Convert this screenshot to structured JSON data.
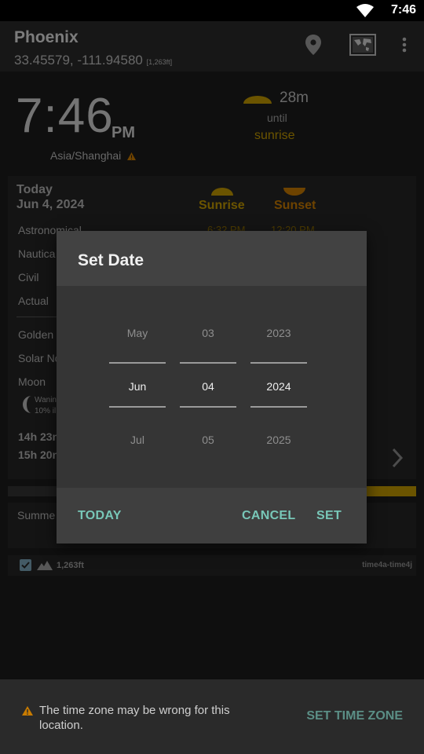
{
  "status_bar": {
    "time": "7:46"
  },
  "app_bar": {
    "title": "Phoenix",
    "coords": "33.45579, -111.94580",
    "elevation": "[1,263ft]"
  },
  "clock": {
    "time": "7:46",
    "ampm": "PM",
    "timezone": "Asia/Shanghai"
  },
  "countdown": {
    "value": "28m",
    "until": "until",
    "event": "sunrise"
  },
  "today_card": {
    "label": "Today",
    "date": "Jun 4, 2024",
    "sunrise_header": "Sunrise",
    "sunset_header": "Sunset",
    "rows": [
      "Astronomical",
      "Nautica",
      "Civil",
      "Actual",
      "Golden",
      "Solar No",
      "Moon"
    ],
    "astro_sunrise": "6:32 PM",
    "astro_sunset": "12:20 PM",
    "moon_phase": "Wanin",
    "moon_illum": "10% il",
    "day_length_1": "14h 23n",
    "day_length_2": "15h 20n"
  },
  "season_card": {
    "label": "Summe"
  },
  "location_row": {
    "elevation": "1,263ft",
    "widget_id": "time4a-time4j"
  },
  "dialog": {
    "title": "Set Date",
    "months": [
      "May",
      "Jun",
      "Jul"
    ],
    "days": [
      "03",
      "04",
      "05"
    ],
    "years": [
      "2023",
      "2024",
      "2025"
    ],
    "today_button": "TODAY",
    "cancel_button": "CANCEL",
    "set_button": "SET"
  },
  "bottom_bar": {
    "message": "The time zone may be wrong for this location.",
    "action": "SET TIME ZONE"
  },
  "colors": {
    "accent": "#c49a00",
    "dialog_button": "#78c7b8",
    "dim_action": "#5b8f86"
  }
}
